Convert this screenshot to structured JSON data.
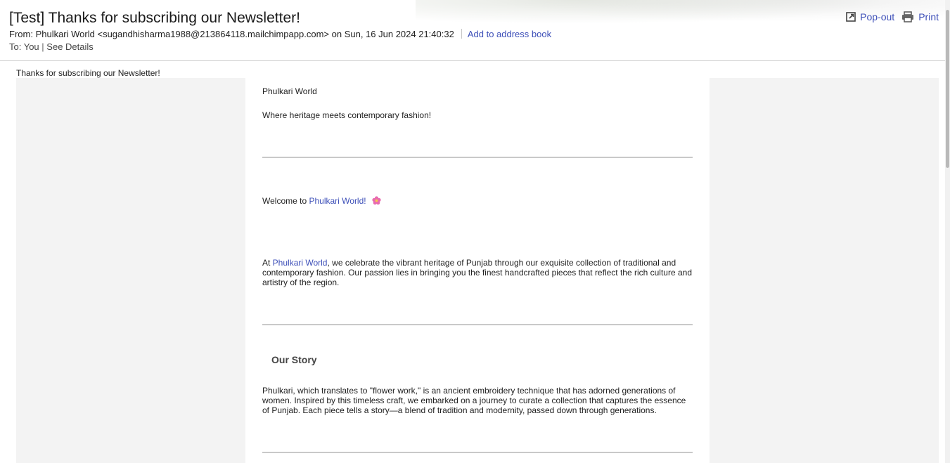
{
  "email": {
    "subject": "[Test] Thanks for subscribing our Newsletter!",
    "from_label": "From: ",
    "from_name": "Phulkari World",
    "from_address": "<sugandhisharma1988@213864118.mailchimpapp.com>",
    "date_text": "on Sun, 16 Jun 2024 21:40:32",
    "add_to_address_book": "Add to address book",
    "to_label": "To: ",
    "to_value": "You",
    "see_details": "See Details"
  },
  "actions": {
    "popout_label": "Pop-out",
    "print_label": "Print",
    "popout_icon": "popout-icon",
    "print_icon": "printer-icon"
  },
  "body": {
    "preheader": "Thanks for subscribing our Newsletter!",
    "brand_name": "Phulkari World",
    "tagline": "Where heritage meets contemporary fashion!",
    "welcome_prefix": "Welcome to ",
    "welcome_link": "Phulkari World!",
    "welcome_icon": "flower-icon",
    "about_prefix": "At ",
    "about_link": "Phulkari World",
    "about_text": ", we celebrate the vibrant heritage of Punjab through our exquisite collection of traditional and contemporary fashion. Our passion lies in bringing you the finest handcrafted pieces that reflect the rich culture and artistry of the region.",
    "story_title": "Our Story",
    "story_text": "Phulkari, which translates to \"flower work,\" is an ancient embroidery technique that has adorned generations of women. Inspired by this timeless craft, we embarked on a journey to curate a collection that captures the essence of Punjab. Each piece tells a story—a blend of tradition and modernity, passed down through generations."
  },
  "colors": {
    "link": "#3d4fb8",
    "gutter": "#f3f3f3",
    "rule": "#c9c9c9",
    "flower": "#e86bb0"
  }
}
